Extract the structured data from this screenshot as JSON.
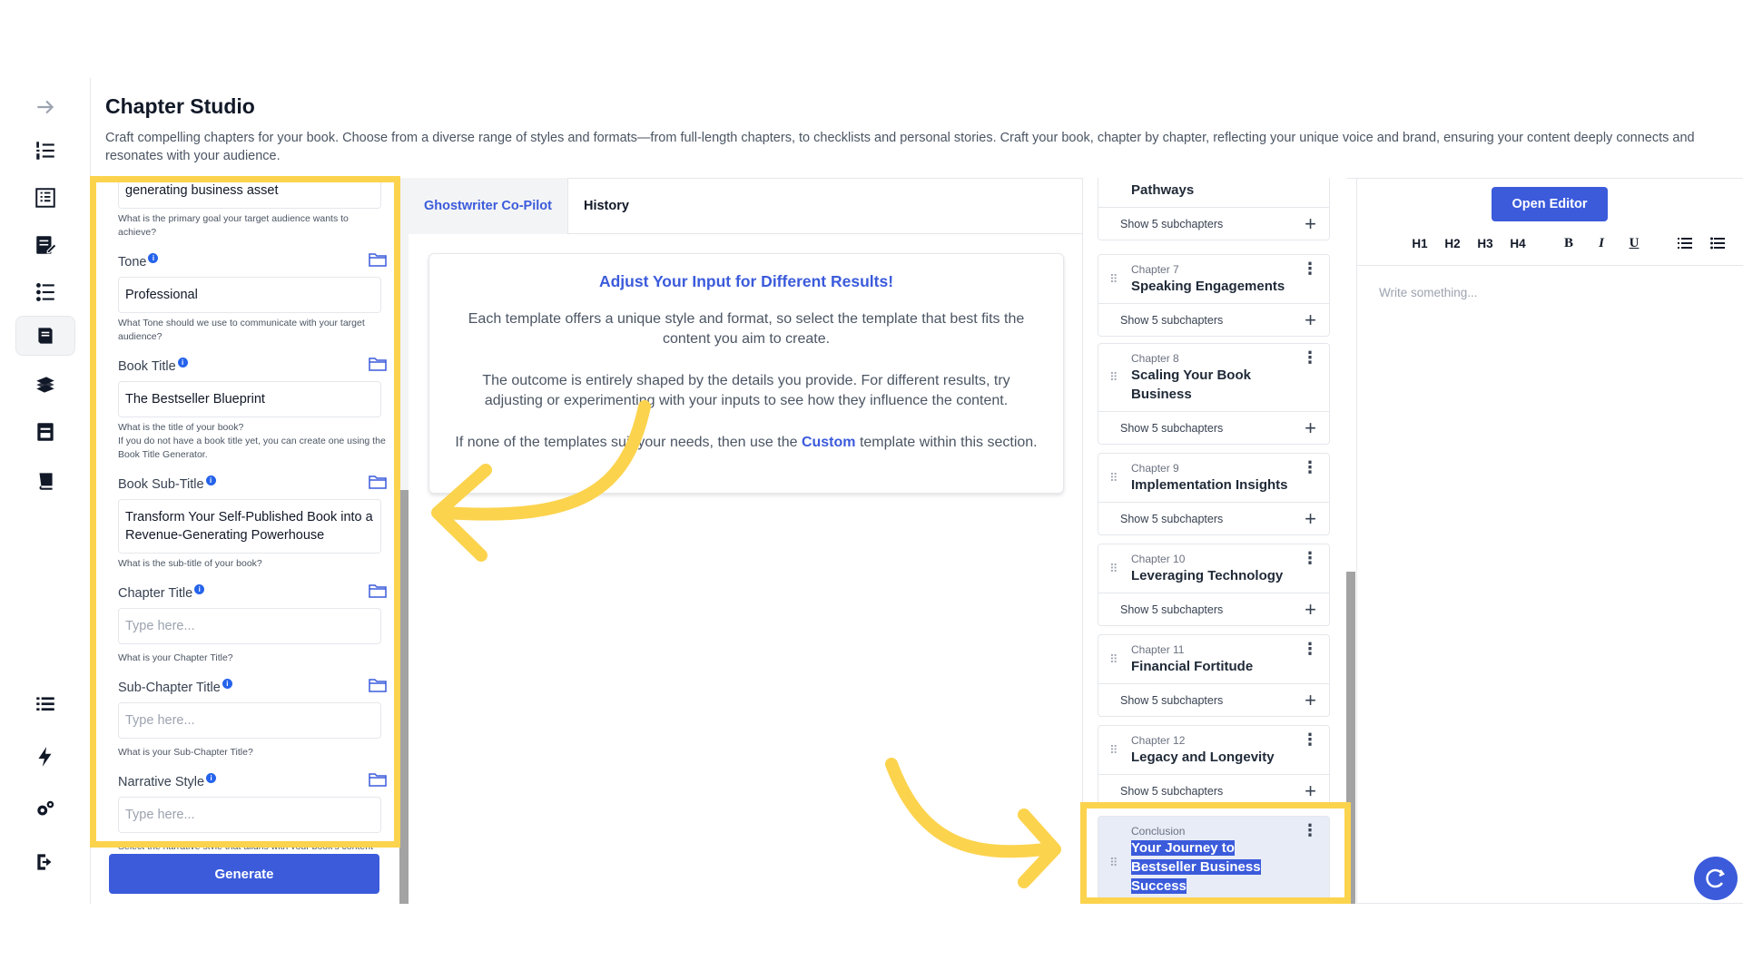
{
  "header": {
    "title": "Chapter Studio",
    "description": "Craft compelling chapters for your book. Choose from a diverse range of styles and formats—from full-length chapters, to checklists and personal stories. Craft your book, chapter by chapter, reflecting your unique voice and brand, ensuring your content deeply connects and resonates with your audience."
  },
  "rail": {
    "icons": [
      "arrow-right-icon",
      "numbered-list-icon",
      "outline-icon",
      "edit-document-icon",
      "checklist-icon",
      "book-chapter-icon",
      "books-stack-icon",
      "archive-icon",
      "book-icon",
      "list-icon",
      "lightning-icon",
      "settings-icon",
      "logout-icon"
    ]
  },
  "form": {
    "top_value": "generating business asset",
    "top_help": "What is the primary goal your target audience wants to achieve?",
    "tone": {
      "label": "Tone",
      "value": "Professional",
      "help": "What Tone should we use to communicate with your target audience?"
    },
    "book_title": {
      "label": "Book Title",
      "value": "The Bestseller Blueprint",
      "help": "What is the title of your book?\nIf you do not have a book title yet, you can create one using the Book Title Generator."
    },
    "book_subtitle": {
      "label": "Book Sub-Title",
      "value": "Transform Your Self-Published Book into a Revenue-Generating Powerhouse",
      "help": "What is the sub-title of your book?"
    },
    "chapter_title": {
      "label": "Chapter Title",
      "placeholder": "Type here...",
      "help": "What is your Chapter Title?"
    },
    "subchapter_title": {
      "label": "Sub-Chapter Title",
      "placeholder": "Type here...",
      "help": "What is your Sub-Chapter Title?"
    },
    "narrative_style": {
      "label": "Narrative Style",
      "placeholder": "Type here...",
      "help": "Select the narrative style that aligns with your book's content and desired impact on the reader. Your choice of narrative style is crucial in establishing the right tone and connection with your audience."
    },
    "generate_label": "Generate"
  },
  "center": {
    "tabs": [
      "Ghostwriter Co-Pilot",
      "History"
    ],
    "card": {
      "heading": "Adjust Your Input for Different Results!",
      "p1": "Each template offers a unique style and format, so select the template that best fits the content you aim to create.",
      "p2": "The outcome is entirely shaped by the details you provide. For different results, try adjusting or experimenting with your inputs to see how they influence the content.",
      "p3_before": "If none of the templates suit your needs, then use the ",
      "p3_link": "Custom",
      "p3_after": " template within this section."
    }
  },
  "chapters": {
    "partial_title": "Pathways",
    "partial_sub": "Show 5 subchapters",
    "items": [
      {
        "num": "Chapter 7",
        "title": "Speaking Engagements",
        "sub": "Show 5 subchapters"
      },
      {
        "num": "Chapter 8",
        "title": "Scaling Your Book Business",
        "sub": "Show 5 subchapters"
      },
      {
        "num": "Chapter 9",
        "title": "Implementation Insights",
        "sub": "Show 5 subchapters"
      },
      {
        "num": "Chapter 10",
        "title": "Leveraging Technology",
        "sub": "Show 5 subchapters"
      },
      {
        "num": "Chapter 11",
        "title": "Financial Fortitude",
        "sub": "Show 5 subchapters"
      },
      {
        "num": "Chapter 12",
        "title": "Legacy and Longevity",
        "sub": "Show 5 subchapters"
      }
    ],
    "conclusion": {
      "num": "Conclusion",
      "title": "Your Journey to Bestseller Business Success"
    }
  },
  "editor": {
    "open_label": "Open Editor",
    "toolbar": [
      "H1",
      "H2",
      "H3",
      "H4",
      "B",
      "I",
      "U"
    ],
    "placeholder": "Write something..."
  },
  "colors": {
    "accent": "#3b5bdb",
    "highlight": "#fcd34d"
  }
}
